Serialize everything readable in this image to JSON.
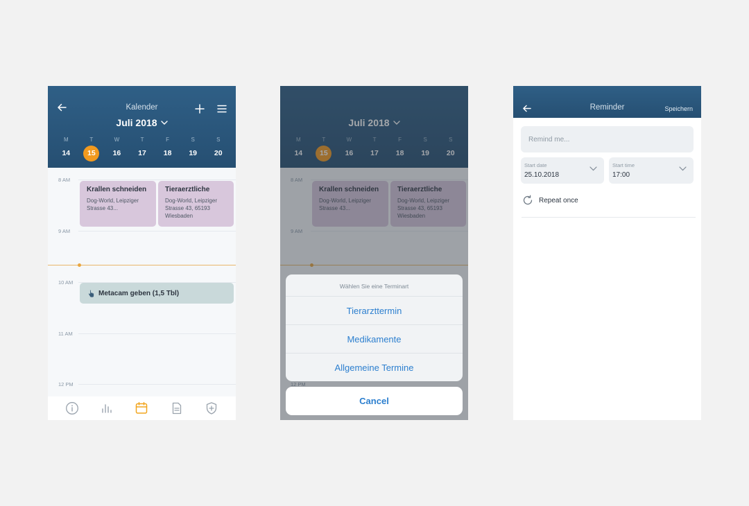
{
  "colors": {
    "header": "#2a5679",
    "accent": "#f29a1f",
    "event_purple": "#d8c7dc",
    "event_teal": "#c9d9da",
    "link_blue": "#2c7fcf"
  },
  "calendar": {
    "title": "Kalender",
    "month": "Juli 2018",
    "weekdays": [
      "M",
      "T",
      "W",
      "T",
      "F",
      "S",
      "S"
    ],
    "days": [
      "14",
      "15",
      "16",
      "17",
      "18",
      "19",
      "20"
    ],
    "selected_day": "15",
    "hours": [
      "8 AM",
      "9 AM",
      "10 AM",
      "11 AM",
      "12 PM"
    ],
    "events": [
      {
        "title": "Krallen schneiden",
        "address": "Dog-World, Leipziger Strasse 43..."
      },
      {
        "title": "Tieraerztliche",
        "address": "Dog-World, Leipziger Strasse 43, 65193 Wiesbaden"
      },
      {
        "title": "Metacam geben (1,5 Tbl)"
      }
    ],
    "tabs": [
      "info-icon",
      "stats-icon",
      "calendar-icon",
      "document-icon",
      "shield-plus-icon"
    ],
    "active_tab": "calendar-icon"
  },
  "picker": {
    "title": "Wählen Sie eine Terminart",
    "options": [
      "Tierarzttermin",
      "Medikamente",
      "Allgemeine Termine"
    ],
    "cancel": "Cancel"
  },
  "reminder": {
    "title": "Reminder",
    "save": "Speichern",
    "remind_placeholder": "Remind me...",
    "start_date_label": "Start date",
    "start_date": "25.10.2018",
    "start_time_label": "Start time",
    "start_time": "17:00",
    "repeat": "Repeat once"
  }
}
